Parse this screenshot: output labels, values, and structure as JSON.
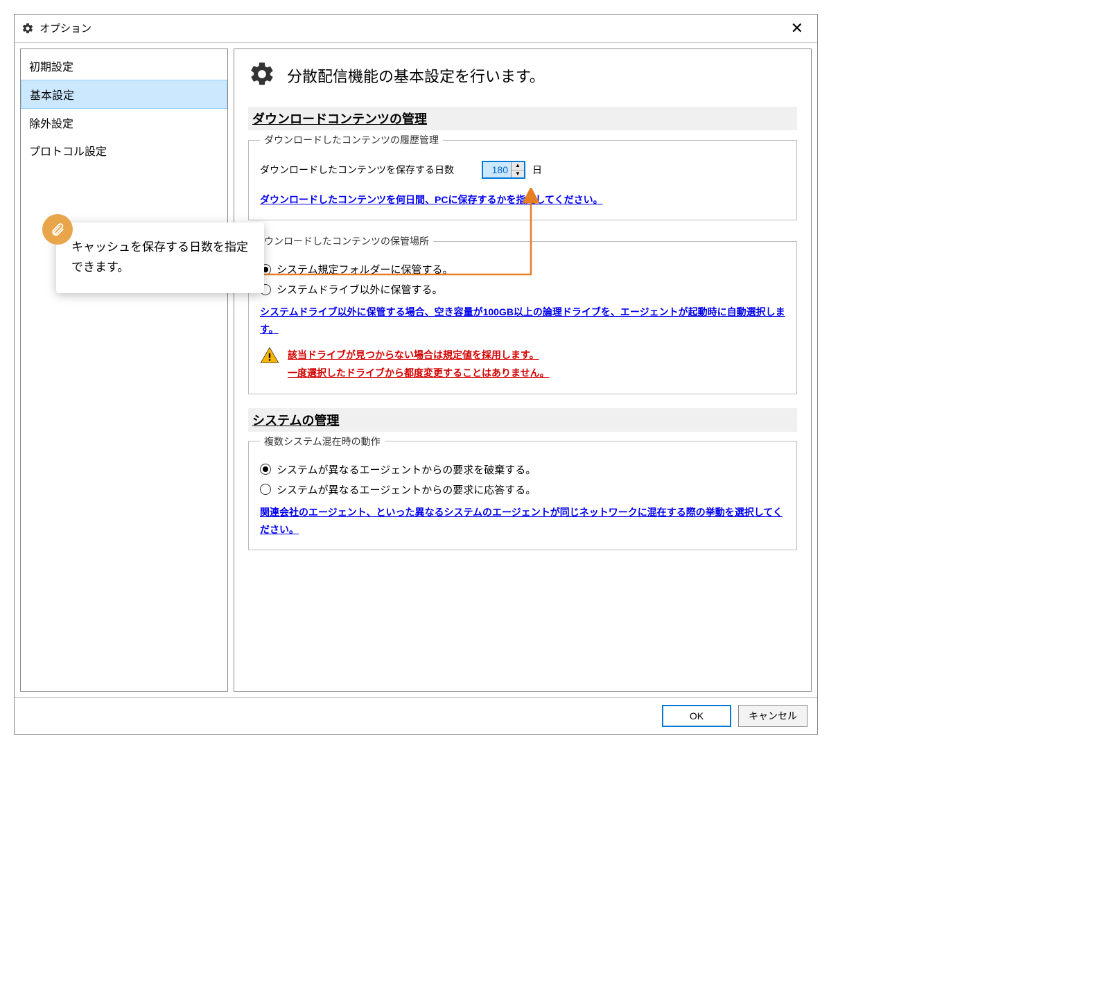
{
  "window": {
    "title": "オプション"
  },
  "sidebar": {
    "items": [
      {
        "label": "初期設定"
      },
      {
        "label": "基本設定"
      },
      {
        "label": "除外設定"
      },
      {
        "label": "プロトコル設定"
      }
    ]
  },
  "heading": "分散配信機能の基本設定を行います。",
  "section1": {
    "title": "ダウンロードコンテンツの管理",
    "group1": {
      "legend": "ダウンロードしたコンテンツの履歴管理",
      "label": "ダウンロードしたコンテンツを保存する日数",
      "value": "180",
      "unit": "日",
      "help": "ダウンロードしたコンテンツを何日間、PCに保存するかを指定してください。"
    },
    "group2": {
      "legend": "ウンロードしたコンテンツの保管場所",
      "opt1": "システム規定フォルダーに保管する。",
      "opt2": "システムドライブ以外に保管する。",
      "help": "システムドライブ以外に保管する場合、空き容量が100GB以上の論理ドライブを、エージェントが起動時に自動選択します。",
      "warn1": "該当ドライブが見つからない場合は規定値を採用します。",
      "warn2": "一度選択したドライブから都度変更することはありません。"
    }
  },
  "section2": {
    "title": "システムの管理",
    "group1": {
      "legend": "複数システム混在時の動作",
      "opt1": "システムが異なるエージェントからの要求を破棄する。",
      "opt2": "システムが異なるエージェントからの要求に応答する。",
      "help": "関連会社のエージェント、といった異なるシステムのエージェントが同じネットワークに混在する際の挙動を選択してください。"
    }
  },
  "callout": {
    "text": "キャッシュを保存する日数を指定できます。"
  },
  "footer": {
    "ok": "OK",
    "cancel": "キャンセル"
  }
}
